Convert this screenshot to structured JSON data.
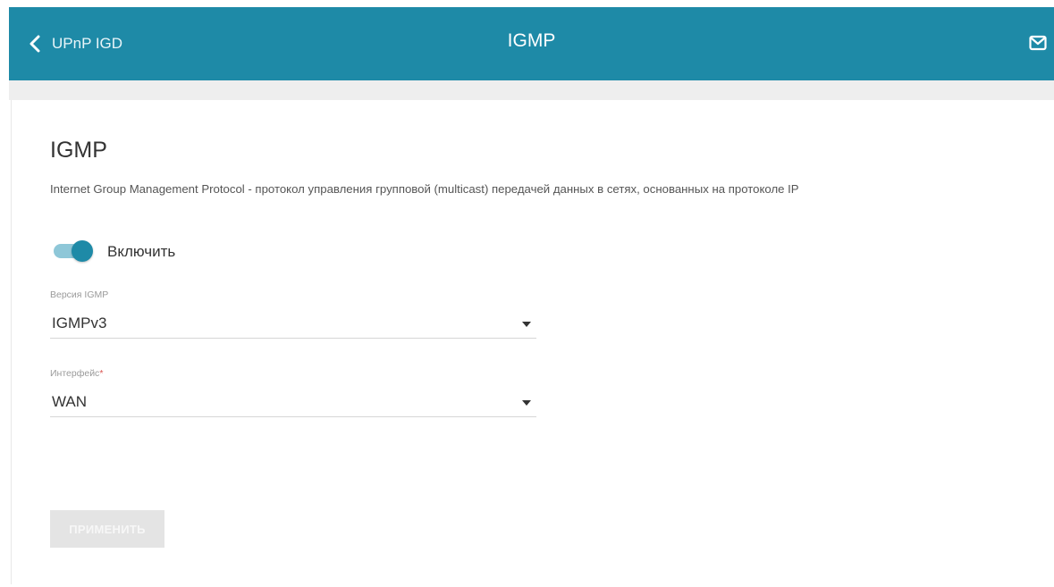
{
  "colors": {
    "header_bg": "#1e8aa7",
    "accent": "#1e8aa7",
    "button_disabled": "#e4e4e4"
  },
  "header": {
    "back_label": "UPnP IGD",
    "back_icon": "chevron-left-icon",
    "title": "IGMP",
    "mail_icon": "mail-icon"
  },
  "main": {
    "title": "IGMP",
    "description": "Internet Group Management Protocol - протокол управления групповой (multicast) передачей данных в сетях, основанных на протоколе IP",
    "enable_toggle": {
      "label": "Включить",
      "checked": true
    },
    "igmp_version": {
      "label": "Версия IGMP",
      "value": "IGMPv3"
    },
    "interface": {
      "label": "Интерфейс",
      "required_mark": "*",
      "value": "WAN"
    },
    "apply_button": {
      "label": "ПРИМЕНИТЬ",
      "disabled": true
    }
  }
}
